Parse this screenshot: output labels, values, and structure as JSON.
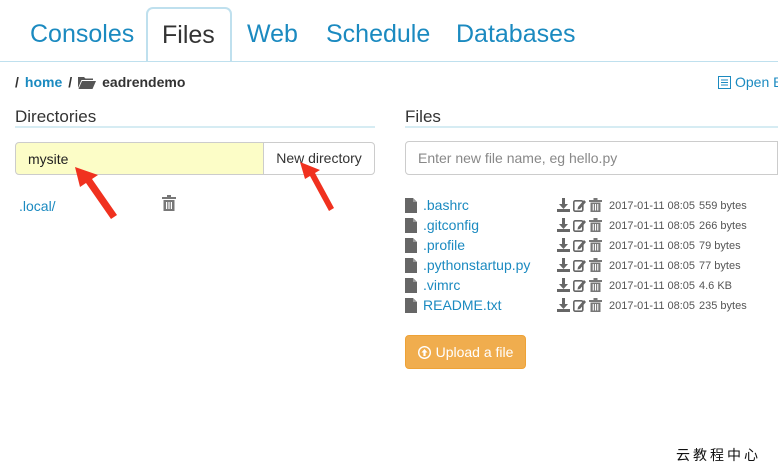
{
  "tabs": [
    {
      "label": "Consoles",
      "active": false
    },
    {
      "label": "Files",
      "active": true
    },
    {
      "label": "Web",
      "active": false
    },
    {
      "label": "Schedule",
      "active": false
    },
    {
      "label": "Databases",
      "active": false
    }
  ],
  "breadcrumb": {
    "sep1": "/",
    "home": "home",
    "sep2": "/",
    "current": "eadrendemo"
  },
  "open_link": "Open B",
  "directories": {
    "title": "Directories",
    "input_value": "mysite",
    "new_button": "New directory",
    "items": [
      ".local/"
    ]
  },
  "files": {
    "title": "Files",
    "input_placeholder": "Enter new file name, eg hello.py",
    "items": [
      {
        "name": ".bashrc",
        "date": "2017-01-11 08:05",
        "size": "559 bytes"
      },
      {
        "name": ".gitconfig",
        "date": "2017-01-11 08:05",
        "size": "266 bytes"
      },
      {
        "name": ".profile",
        "date": "2017-01-11 08:05",
        "size": "79 bytes"
      },
      {
        "name": ".pythonstartup.py",
        "date": "2017-01-11 08:05",
        "size": "77 bytes"
      },
      {
        "name": ".vimrc",
        "date": "2017-01-11 08:05",
        "size": "4.6 KB"
      },
      {
        "name": "README.txt",
        "date": "2017-01-11 08:05",
        "size": "235 bytes"
      }
    ],
    "upload_label": "Upload a file"
  },
  "watermark": "云教程中心",
  "colors": {
    "accent": "#1b8ac0",
    "upload": "#f0ad4e",
    "highlight_input": "#fcfdc7",
    "annotation_arrow": "#f0311f"
  }
}
